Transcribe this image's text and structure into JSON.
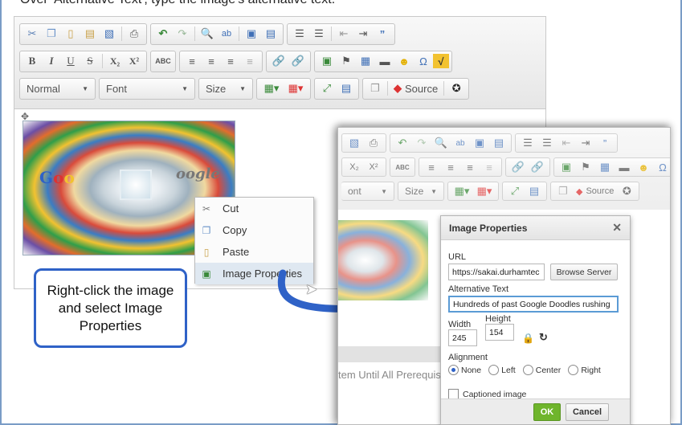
{
  "caption": "Over 'Alternative Text', type the image's alternative text.",
  "editor": {
    "toolbar_row1": [
      "cut-icon",
      "copy-icon",
      "paste-icon",
      "paste-text-icon",
      "paste-word-icon",
      "print-icon",
      "undo-icon",
      "redo-icon",
      "find-icon",
      "replace-icon",
      "select-all-icon",
      "spellcheck-icon",
      "numbered-list-icon",
      "bulleted-list-icon",
      "outdent-icon",
      "indent-icon",
      "blockquote-icon"
    ],
    "format_combo": "Normal",
    "font_combo": "Font",
    "size_combo": "Size",
    "source_label": "Source"
  },
  "context_menu": {
    "items": [
      {
        "label": "Cut",
        "icon": "scissors-icon"
      },
      {
        "label": "Copy",
        "icon": "copy-icon"
      },
      {
        "label": "Paste",
        "icon": "paste-icon"
      },
      {
        "label": "Image Properties",
        "icon": "image-properties-icon"
      }
    ]
  },
  "callout": {
    "text": "Right-click the image and select Image Properties"
  },
  "inset": {
    "format_partial": "ont",
    "size_combo": "Size",
    "source_label": "Source",
    "background_text": "tem Until All Prerequisi"
  },
  "dialog": {
    "title": "Image Properties",
    "url_label": "URL",
    "url_value": "https://sakai.durhamtec",
    "browse_label": "Browse Server",
    "alt_label": "Alternative Text",
    "alt_value": "Hundreds of past Google Doodles rushing",
    "width_label": "Width",
    "width_value": "245",
    "height_label": "Height",
    "height_value": "154",
    "alignment_label": "Alignment",
    "align_options": [
      "None",
      "Left",
      "Center",
      "Right"
    ],
    "align_selected": "None",
    "captioned_label": "Captioned image",
    "ok_label": "OK",
    "cancel_label": "Cancel"
  }
}
